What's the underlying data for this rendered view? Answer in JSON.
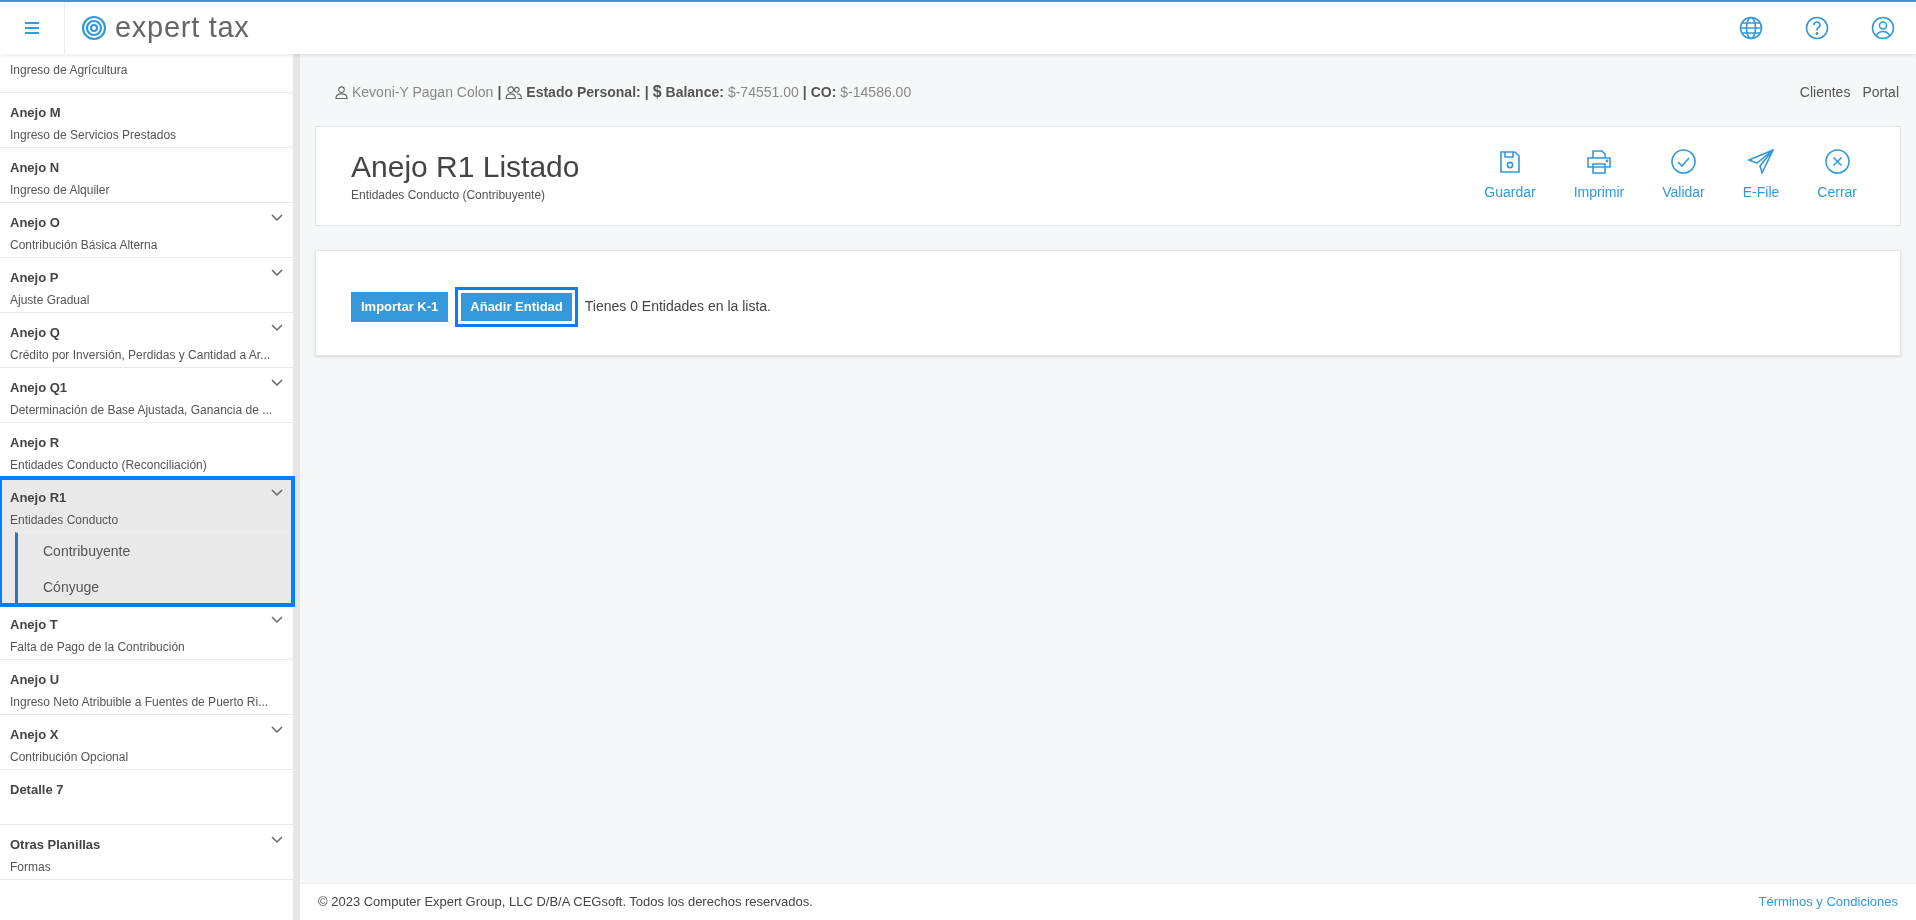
{
  "header": {
    "brand": "expert tax"
  },
  "sidebar": {
    "items": [
      {
        "subtitle": "Ingreso de Agrícultura",
        "expandable": false,
        "selected": false
      },
      {
        "title": "Anejo M",
        "subtitle": "Ingreso de Servicios Prestados",
        "expandable": false,
        "selected": false
      },
      {
        "title": "Anejo N",
        "subtitle": "Ingreso de Alquiler",
        "expandable": false,
        "selected": false
      },
      {
        "title": "Anejo O",
        "subtitle": "Contribución Básica Alterna",
        "expandable": true,
        "selected": false
      },
      {
        "title": "Anejo P",
        "subtitle": "Ajuste Gradual",
        "expandable": true,
        "selected": false
      },
      {
        "title": "Anejo Q",
        "subtitle": "Crédito por Inversión, Perdidas y Cantidad a Ar...",
        "expandable": true,
        "selected": false
      },
      {
        "title": "Anejo Q1",
        "subtitle": "Determinación de Base Ajustada, Ganancia de ...",
        "expandable": true,
        "selected": false
      },
      {
        "title": "Anejo R",
        "subtitle": "Entidades Conducto (Reconciliación)",
        "expandable": false,
        "selected": false
      },
      {
        "title": "Anejo R1",
        "subtitle": "Entidades Conducto",
        "expandable": true,
        "selected": true,
        "children": [
          "Contribuyente",
          "Cónyuge"
        ]
      },
      {
        "title": "Anejo T",
        "subtitle": "Falta de Pago de la Contribución",
        "expandable": true,
        "selected": false
      },
      {
        "title": "Anejo U",
        "subtitle": "Ingreso Neto Atribuible a Fuentes de Puerto Ri...",
        "expandable": false,
        "selected": false
      },
      {
        "title": "Anejo X",
        "subtitle": "Contribución Opcional",
        "expandable": true,
        "selected": false
      },
      {
        "title": "Detalle 7",
        "expandable": false,
        "selected": false
      },
      {
        "title": "Otras Planillas",
        "subtitle": "Formas",
        "expandable": true,
        "selected": false
      }
    ]
  },
  "info_bar": {
    "separators": [
      "|",
      "|",
      "|"
    ],
    "currency_symbol": "$",
    "client": "Kevoni-Y Pagan Colon",
    "estado_label": "Estado Personal:",
    "balance_label": "Balance:",
    "balance": "$-74551.00",
    "co_label": "CO:",
    "co": "$-14586.00",
    "links": [
      "Clientes",
      "Portal"
    ]
  },
  "page": {
    "title": "Anejo R1 Listado",
    "subtitle": "Entidades Conducto (Contribuyente)",
    "actions": [
      {
        "kind": "save",
        "label": "Guardar"
      },
      {
        "kind": "print",
        "label": "Imprimir"
      },
      {
        "kind": "validate",
        "label": "Validar"
      },
      {
        "kind": "efile",
        "label": "E-File"
      },
      {
        "kind": "close",
        "label": "Cerrar"
      }
    ]
  },
  "list": {
    "buttons": [
      {
        "label": "Importar K-1",
        "focused": false
      },
      {
        "label": "Añadir Entidad",
        "focused": true
      }
    ],
    "message": "Tienes 0 Entidades en la lista."
  },
  "footer": {
    "copyright": "© 2023 Computer Expert Group, LLC D/B/A CEGsoft. Todos los derechos reservados.",
    "link": "Términos y Condiciones"
  }
}
